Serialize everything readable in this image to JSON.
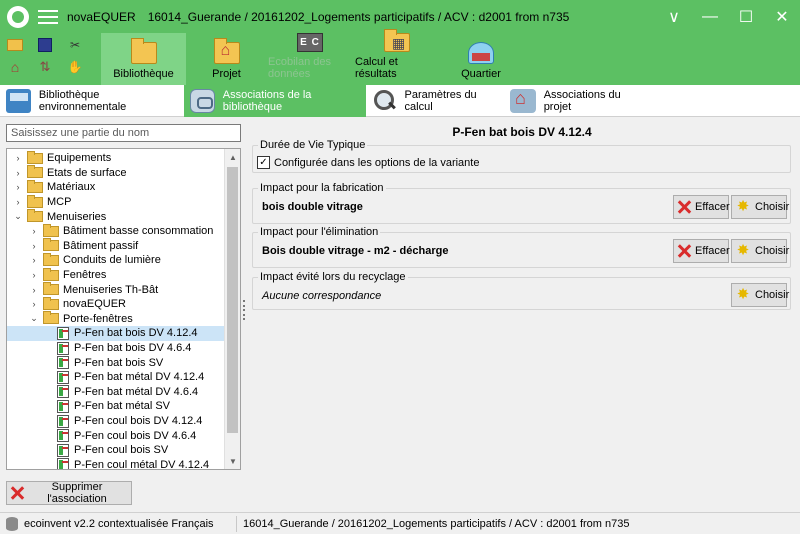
{
  "window": {
    "app_name": "novaEQUER",
    "title": "16014_Guerande / 20161202_Logements participatifs / ACV : d2001 from n735",
    "controls": {
      "chevron": "∨",
      "minimize": "—",
      "maximize": "☐",
      "close": "✕"
    }
  },
  "quick_tools": [
    "folder-open-icon",
    "save-icon",
    "tools-icon",
    "home-icon",
    "arrows-icon",
    "hand-icon"
  ],
  "ribbon": {
    "buttons": [
      {
        "label": "Bibliothèque",
        "active": true
      },
      {
        "label": "Projet"
      },
      {
        "label": "Ecobilan des données",
        "disabled": true,
        "icon_text": "E C"
      },
      {
        "label": "Calcul et résultats"
      },
      {
        "label": "Quartier"
      }
    ]
  },
  "tabs": [
    {
      "label": "Bibliothèque environnementale"
    },
    {
      "label": "Associations de la bibliothèque",
      "active": true
    },
    {
      "label": "Paramètres du calcul"
    },
    {
      "label": "Associations du projet"
    }
  ],
  "left": {
    "search_placeholder": "Saisissez une partie du nom",
    "tree": [
      {
        "label": "Equipements",
        "level": 0,
        "expanded": false
      },
      {
        "label": "Etats de surface",
        "level": 0,
        "expanded": false
      },
      {
        "label": "Matériaux",
        "level": 0,
        "expanded": false
      },
      {
        "label": "MCP",
        "level": 0,
        "expanded": false
      },
      {
        "label": "Menuiseries",
        "level": 0,
        "expanded": true
      },
      {
        "label": "Bâtiment basse consommation",
        "level": 1,
        "expanded": false
      },
      {
        "label": "Bâtiment passif",
        "level": 1,
        "expanded": false
      },
      {
        "label": "Conduits de lumière",
        "level": 1,
        "expanded": false
      },
      {
        "label": "Fenêtres",
        "level": 1,
        "expanded": false
      },
      {
        "label": "Menuiseries Th-Bât",
        "level": 1,
        "expanded": false
      },
      {
        "label": "novaEQUER",
        "level": 1,
        "expanded": false
      },
      {
        "label": "Porte-fenêtres",
        "level": 1,
        "expanded": true
      },
      {
        "label": "P-Fen bat bois DV 4.12.4",
        "level": 2,
        "leaf": true,
        "selected": true
      },
      {
        "label": "P-Fen bat bois DV 4.6.4",
        "level": 2,
        "leaf": true
      },
      {
        "label": "P-Fen bat bois SV",
        "level": 2,
        "leaf": true
      },
      {
        "label": "P-Fen bat métal DV 4.12.4",
        "level": 2,
        "leaf": true
      },
      {
        "label": "P-Fen bat métal DV 4.6.4",
        "level": 2,
        "leaf": true
      },
      {
        "label": "P-Fen bat métal SV",
        "level": 2,
        "leaf": true
      },
      {
        "label": "P-Fen coul bois DV 4.12.4",
        "level": 2,
        "leaf": true
      },
      {
        "label": "P-Fen coul bois DV 4.6.4",
        "level": 2,
        "leaf": true
      },
      {
        "label": "P-Fen coul bois SV",
        "level": 2,
        "leaf": true
      },
      {
        "label": "P-Fen coul métal DV 4.12.4",
        "level": 2,
        "leaf": true
      }
    ],
    "delete_button": "Supprimer l'association"
  },
  "right": {
    "title": "P-Fen bat bois DV 4.12.4",
    "life": {
      "label": "Durée de Vie Typique",
      "checkbox_label": "Configurée dans les options de la variante",
      "checked": true
    },
    "fabrication": {
      "label": "Impact pour la fabrication",
      "value": "bois double vitrage"
    },
    "elimination": {
      "label": "Impact pour l'élimination",
      "value": "Bois double vitrage - m2 - décharge"
    },
    "recycling": {
      "label": "Impact évité lors du recyclage",
      "value": "Aucune correspondance"
    },
    "clear_label": "Effacer",
    "choose_label": "Choisir"
  },
  "status": {
    "database": "ecoinvent v2.2 contextualisée Français",
    "project": "16014_Guerande / 20161202_Logements participatifs / ACV : d2001 from n735"
  }
}
